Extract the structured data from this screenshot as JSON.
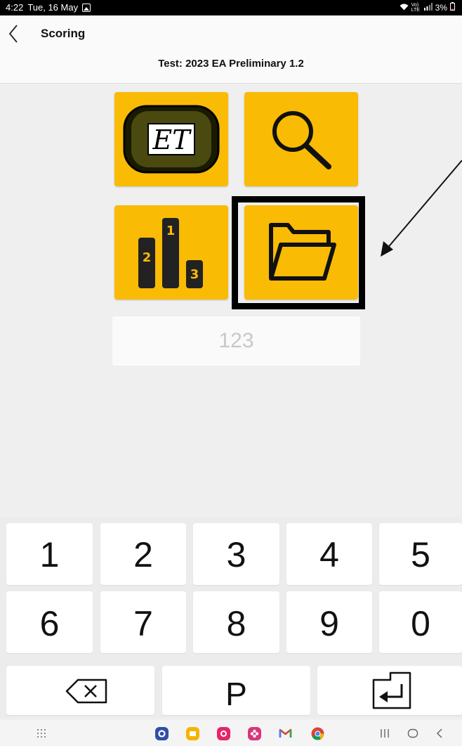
{
  "status_bar": {
    "time": "4:22",
    "date": "Tue, 16 May",
    "signal_text": "Vo) LTE",
    "battery": "3%"
  },
  "header": {
    "title": "Scoring",
    "subtitle": "Test: 2023 EA Preliminary 1.2"
  },
  "tiles": {
    "timing_logo_text": "ET",
    "podium_labels": [
      "2",
      "1",
      "3"
    ]
  },
  "number_field": {
    "placeholder": "123"
  },
  "keypad": {
    "row1": [
      "1",
      "2",
      "3",
      "4",
      "5"
    ],
    "row2": [
      "6",
      "7",
      "8",
      "9",
      "0"
    ],
    "p_key": "P"
  },
  "colors": {
    "tile_yellow": "#f9bb03",
    "status_bar": "#000000",
    "background": "#efefef"
  },
  "nav_apps": [
    "settings-app",
    "files-app",
    "camera-app",
    "flower-app",
    "gmail-app",
    "chrome-app"
  ]
}
